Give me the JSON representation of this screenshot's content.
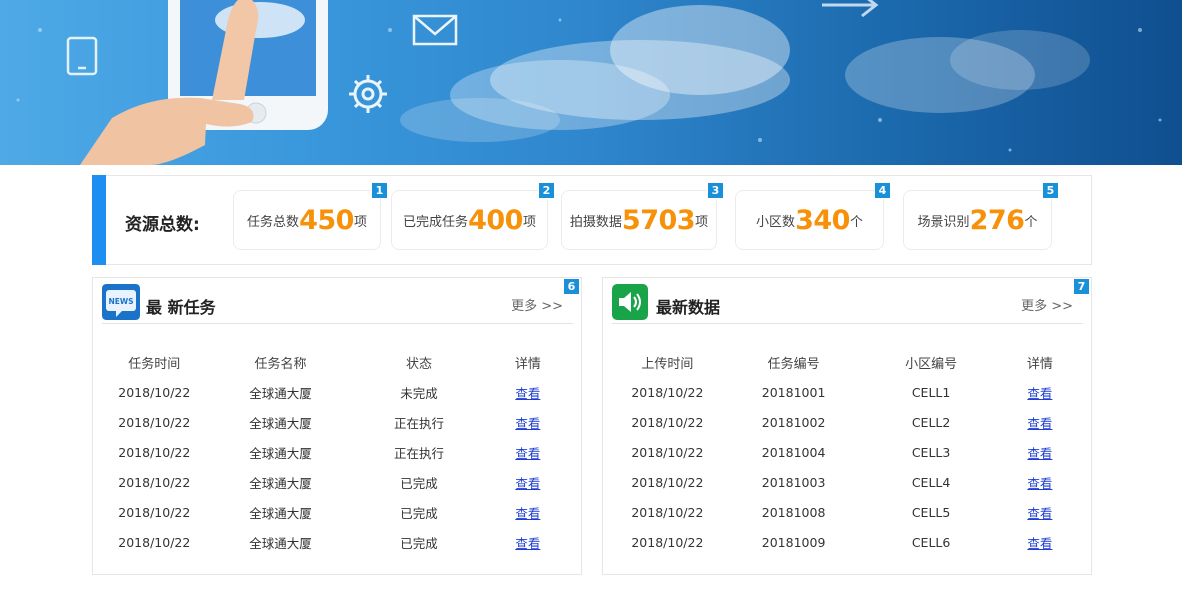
{
  "banner": {
    "icons": [
      "tablet-icon",
      "mail-icon",
      "gear-icon",
      "arrow-icon",
      "phone-hand-image",
      "cloud-image"
    ]
  },
  "stats": {
    "label": "资源总数:",
    "items": [
      {
        "badge": "1",
        "name": "任务总数",
        "value": "450",
        "unit": "项"
      },
      {
        "badge": "2",
        "name": "已完成任务",
        "value": "400",
        "unit": "项"
      },
      {
        "badge": "3",
        "name": "拍摄数据",
        "value": "5703",
        "unit": "项"
      },
      {
        "badge": "4",
        "name": "小区数",
        "value": "340",
        "unit": "个"
      },
      {
        "badge": "5",
        "name": "场景识别",
        "value": "276",
        "unit": "个"
      }
    ]
  },
  "tasks": {
    "badge": "6",
    "title": "最 新任务",
    "icon_text": "NEWS",
    "more": "更多 >>",
    "columns": [
      "任务时间",
      "任务名称",
      "状态",
      "详情"
    ],
    "rows": [
      [
        "2018/10/22",
        "全球通大厦",
        "未完成",
        "查看"
      ],
      [
        "2018/10/22",
        "全球通大厦",
        "正在执行",
        "查看"
      ],
      [
        "2018/10/22",
        "全球通大厦",
        "正在执行",
        "查看"
      ],
      [
        "2018/10/22",
        "全球通大厦",
        "已完成",
        "查看"
      ],
      [
        "2018/10/22",
        "全球通大厦",
        "已完成",
        "查看"
      ],
      [
        "2018/10/22",
        "全球通大厦",
        "已完成",
        "查看"
      ]
    ]
  },
  "data": {
    "badge": "7",
    "title": "最新数据",
    "more": "更多 >>",
    "columns": [
      "上传时间",
      "任务编号",
      "小区编号",
      "详情"
    ],
    "rows": [
      [
        "2018/10/22",
        "20181001",
        "CELL1",
        "查看"
      ],
      [
        "2018/10/22",
        "20181002",
        "CELL2",
        "查看"
      ],
      [
        "2018/10/22",
        "20181004",
        "CELL3",
        "查看"
      ],
      [
        "2018/10/22",
        "20181003",
        "CELL4",
        "查看"
      ],
      [
        "2018/10/22",
        "20181008",
        "CELL5",
        "查看"
      ],
      [
        "2018/10/22",
        "20181009",
        "CELL6",
        "查看"
      ]
    ]
  },
  "colors": {
    "accent": "#1e8ef0",
    "number": "#f7910a",
    "badge": "#1a90d8",
    "link": "#1f3fd3",
    "news_icon": "#1a73c9",
    "speaker_icon": "#19a44a"
  }
}
